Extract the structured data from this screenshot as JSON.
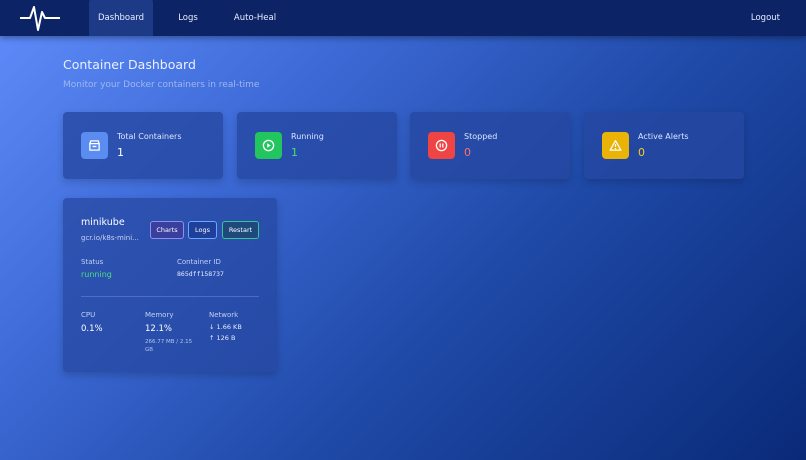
{
  "nav": {
    "tabs": [
      "Dashboard",
      "Logs",
      "Auto-Heal"
    ],
    "active": "Dashboard",
    "logout_label": "Logout"
  },
  "page": {
    "title": "Container Dashboard",
    "subtitle": "Monitor your Docker containers in real-time"
  },
  "stats": [
    {
      "label": "Total Containers",
      "value": "1",
      "icon": "box-icon",
      "icon_bg": "#5b8cf0",
      "value_color": "#ffffff"
    },
    {
      "label": "Running",
      "value": "1",
      "icon": "play-icon",
      "icon_bg": "#22c55e",
      "value_color": "#4ade80"
    },
    {
      "label": "Stopped",
      "value": "0",
      "icon": "pause-icon",
      "icon_bg": "#ef4444",
      "value_color": "#f87171"
    },
    {
      "label": "Active Alerts",
      "value": "0",
      "icon": "warning-icon",
      "icon_bg": "#eab308",
      "value_color": "#facc15"
    }
  ],
  "container": {
    "name": "minikube",
    "image": "gcr.io/k8s-mini...",
    "buttons": {
      "charts": "Charts",
      "logs": "Logs",
      "restart": "Restart"
    },
    "status_label": "Status",
    "status_value": "running",
    "status_color": "#4ade80",
    "id_label": "Container ID",
    "id_value": "865dff158737",
    "cpu_label": "CPU",
    "cpu_value": "0.1%",
    "memory_label": "Memory",
    "memory_value": "12.1%",
    "memory_detail": "266.77 MB / 2.15 GB",
    "network_label": "Network",
    "network_down": "↓ 1.66 KB",
    "network_up": "↑ 126 B"
  }
}
